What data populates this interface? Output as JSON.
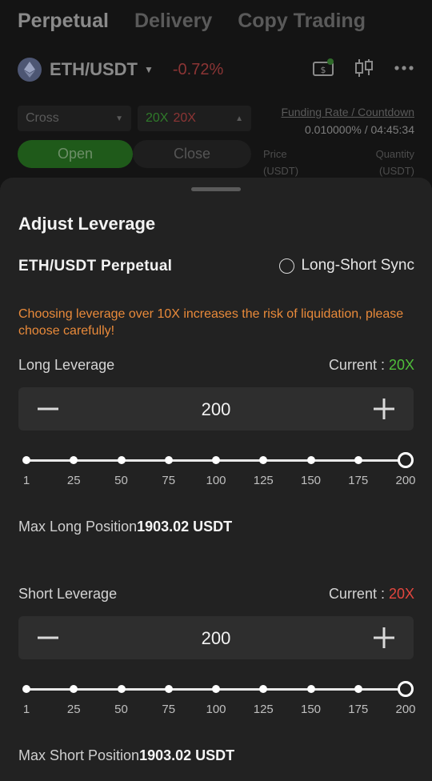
{
  "header": {
    "tabs": [
      {
        "label": "Perpetual",
        "active": true
      },
      {
        "label": "Delivery",
        "active": false
      },
      {
        "label": "Copy Trading",
        "active": false
      }
    ]
  },
  "pair": {
    "name": "ETH/USDT",
    "change": "-0.72%",
    "icons": [
      "eth-logo-icon",
      "caret-down-icon",
      "ticket-icon",
      "candlestick-chart-icon",
      "more-dots-icon"
    ]
  },
  "controls": {
    "margin_mode": "Cross",
    "long_leverage": "20X",
    "short_leverage": "20X",
    "funding_label": "Funding Rate / Countdown",
    "funding_value": "0.010000% / 04:45:34",
    "open_label": "Open",
    "close_label": "Close",
    "price_label": "Price",
    "price_unit": "(USDT)",
    "quantity_label": "Quantity",
    "quantity_unit": "(USDT)"
  },
  "sheet": {
    "title": "Adjust Leverage",
    "contract": "ETH/USDT Perpetual",
    "sync_label": "Long-Short Sync",
    "warning": "Choosing leverage over 10X increases the risk of liquidation, please choose carefully!",
    "long": {
      "label": "Long Leverage",
      "current_prefix": "Current : ",
      "current_value": "20X",
      "input_value": "200",
      "slider_value": 200,
      "max_label": "Max Long Position",
      "max_value": "1903.02 USDT"
    },
    "short": {
      "label": "Short Leverage",
      "current_prefix": "Current : ",
      "current_value": "20X",
      "input_value": "200",
      "slider_value": 200,
      "max_label": "Max Short Position",
      "max_value": "1903.02 USDT"
    },
    "slider_ticks": [
      "1",
      "25",
      "50",
      "75",
      "100",
      "125",
      "150",
      "175",
      "200"
    ],
    "slider_min": 1,
    "slider_max": 200
  },
  "colors": {
    "positive": "#4fbf3a",
    "negative": "#e2463e",
    "warning": "#e98a3a"
  }
}
